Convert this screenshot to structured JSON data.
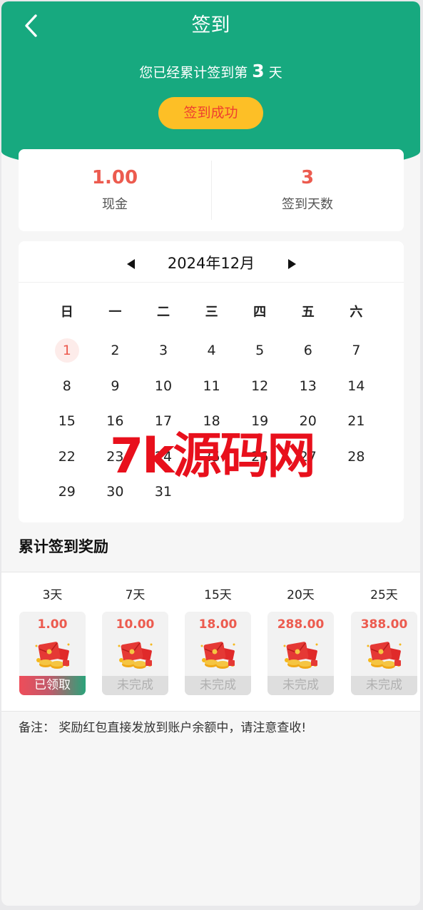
{
  "header": {
    "title": "签到",
    "streak_prefix": "您已经累计签到第",
    "streak_days": "3",
    "streak_suffix": "天",
    "sign_button": "签到成功"
  },
  "stats": [
    {
      "value": "1.00",
      "label": "现金"
    },
    {
      "value": "3",
      "label": "签到天数"
    }
  ],
  "calendar": {
    "month": "2024年12月",
    "weekdays": [
      "日",
      "一",
      "二",
      "三",
      "四",
      "五",
      "六"
    ],
    "weeks": [
      [
        "1",
        "2",
        "3",
        "4",
        "5",
        "6",
        "7"
      ],
      [
        "8",
        "9",
        "10",
        "11",
        "12",
        "13",
        "14"
      ],
      [
        "15",
        "16",
        "17",
        "18",
        "19",
        "20",
        "21"
      ],
      [
        "22",
        "23",
        "24",
        "25",
        "26",
        "27",
        "28"
      ],
      [
        "29",
        "30",
        "31",
        "",
        "",
        "",
        ""
      ]
    ],
    "signed_days": [
      "1"
    ]
  },
  "watermark": "7k源码网",
  "rewards_title": "累计签到奖励",
  "rewards": [
    {
      "days": "3天",
      "amount": "1.00",
      "status": "已领取",
      "claimed": true
    },
    {
      "days": "7天",
      "amount": "10.00",
      "status": "未完成",
      "claimed": false
    },
    {
      "days": "15天",
      "amount": "18.00",
      "status": "未完成",
      "claimed": false
    },
    {
      "days": "20天",
      "amount": "288.00",
      "status": "未完成",
      "claimed": false
    },
    {
      "days": "25天",
      "amount": "388.00",
      "status": "未完成",
      "claimed": false
    }
  ],
  "note": "备注： 奖励红包直接发放到账户余额中，请注意查收!",
  "colors": {
    "header_bg": "#17a97f",
    "button_bg": "#fdbf26",
    "accent_red": "#ec5b4f"
  },
  "icons": {
    "back": "chevron-left-icon",
    "prev_month": "triangle-left-icon",
    "next_month": "triangle-right-icon",
    "reward": "red-envelope-icon"
  }
}
